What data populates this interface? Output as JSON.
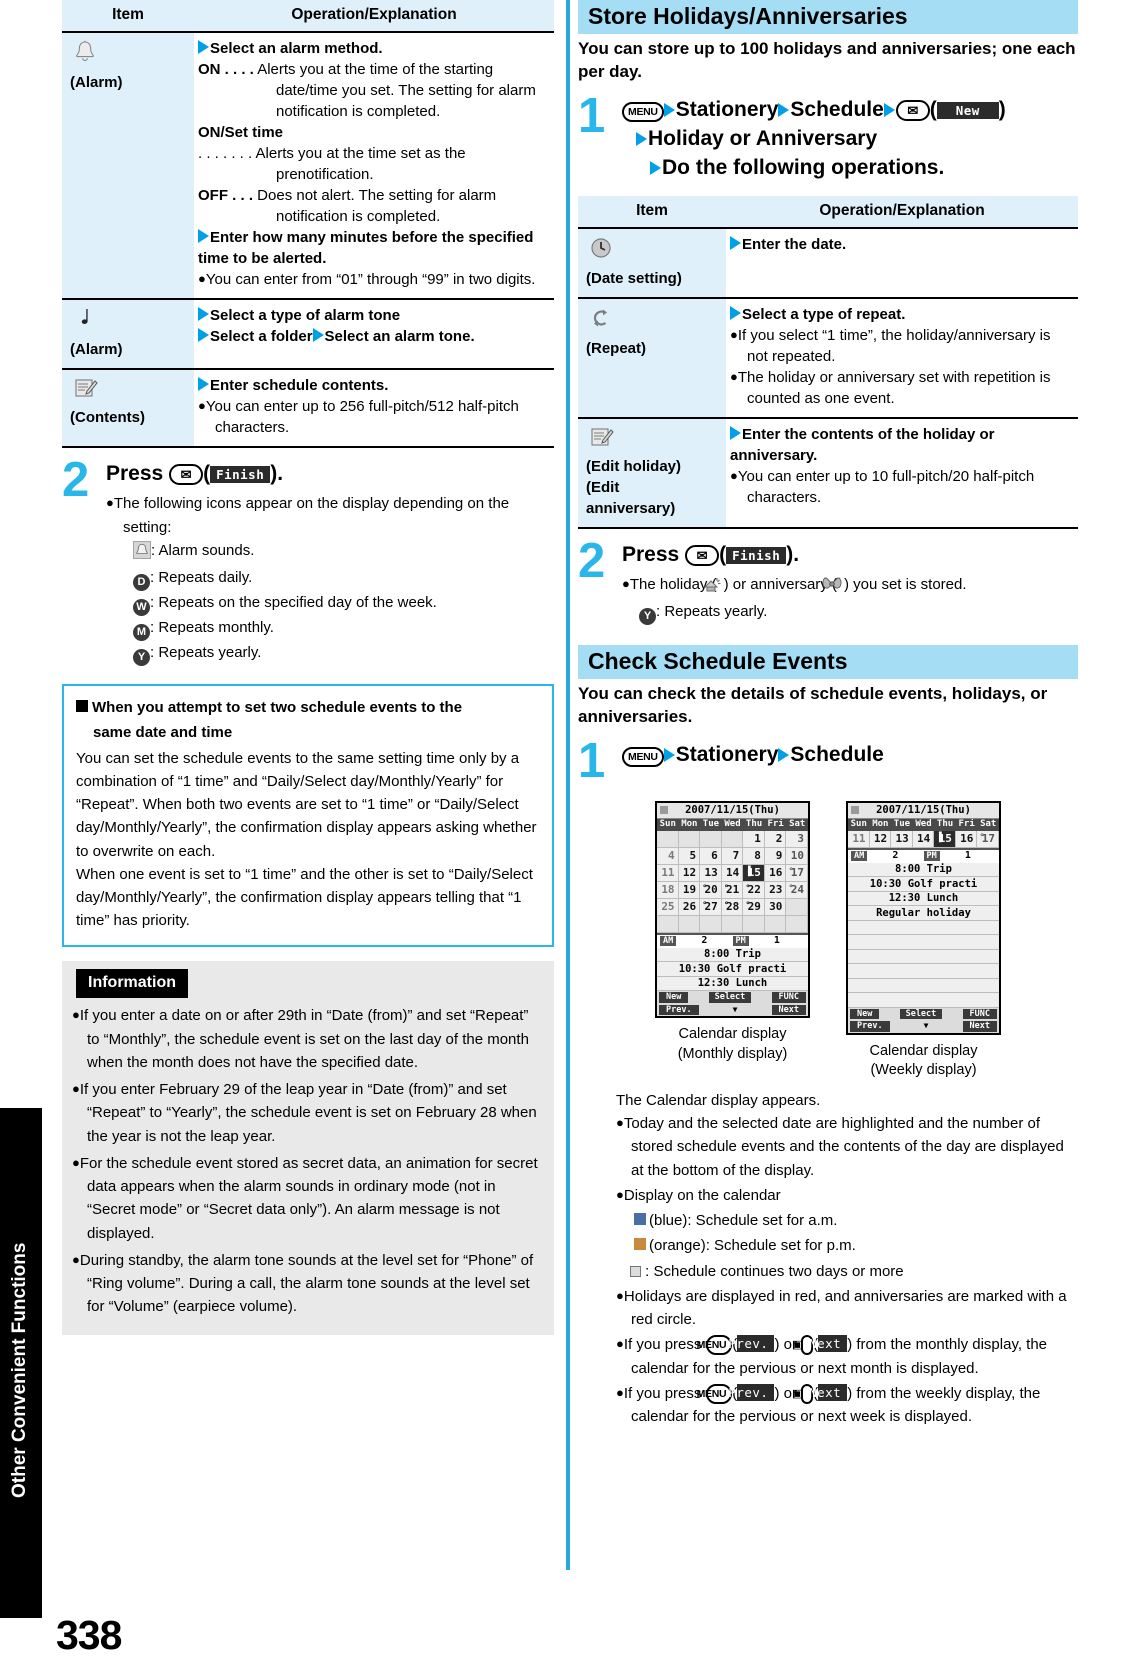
{
  "page": {
    "number": "338",
    "side_tab": "Other Convenient Functions"
  },
  "left": {
    "table": {
      "headers": [
        "Item",
        "Operation/Explanation"
      ],
      "rows": [
        {
          "icon": "bell-icon",
          "item_label": "(Alarm)",
          "lines": [
            {
              "type": "arrow-bold",
              "text": "Select an alarm method."
            },
            {
              "type": "def",
              "term": "ON . . . .",
              "text": "Alerts you at the time of the starting date/time you set. The setting for alarm notification is completed."
            },
            {
              "type": "term-only",
              "text": "ON/Set time"
            },
            {
              "type": "def",
              "term": ". . . . . . .",
              "text": "Alerts you at the time set as the prenotification."
            },
            {
              "type": "def",
              "term": "OFF . . .",
              "text": "Does not alert. The setting for alarm notification is completed."
            },
            {
              "type": "arrow-bold",
              "text": "Enter how many minutes before the specified time to be alerted."
            },
            {
              "type": "bullet",
              "text": "You can enter from “01” through “99” in two digits."
            }
          ]
        },
        {
          "icon": "music-note-icon",
          "item_label": "(Alarm)",
          "lines": [
            {
              "type": "arrow-bold",
              "text": "Select a type of alarm tone"
            },
            {
              "type": "arrow-bold-double",
              "text1": "Select a folder",
              "text2": "Select an alarm tone."
            }
          ]
        },
        {
          "icon": "memo-icon",
          "item_label": "(Contents)",
          "lines": [
            {
              "type": "arrow-bold",
              "text": "Enter schedule contents."
            },
            {
              "type": "bullet",
              "text": "You can enter up to 256 full-pitch/512 half-pitch characters."
            }
          ]
        }
      ]
    },
    "step2": {
      "number": "2",
      "press_label": "Press",
      "key": "envelope-key",
      "softkey": "Finish",
      "period": ").",
      "bullet": "The following icons appear on the display depending on the setting:",
      "icon_list": [
        {
          "icon": "bell-icon",
          "text": ": Alarm sounds."
        },
        {
          "icon": "D",
          "text": ": Repeats daily."
        },
        {
          "icon": "W",
          "text": ": Repeats on the specified day of the week."
        },
        {
          "icon": "M",
          "text": ": Repeats monthly."
        },
        {
          "icon": "Y",
          "text": ": Repeats yearly."
        }
      ]
    },
    "notebox": {
      "title_line1": "When you attempt to set two schedule events to the",
      "title_line2": "same date and time",
      "paragraphs": [
        "You can set the schedule events to the same setting time only by a combination of “1 time” and “Daily/Select day/Monthly/Yearly” for “Repeat”. When both two events are set to “1 time” or “Daily/Select day/Monthly/Yearly”, the confirmation display appears asking whether to overwrite on each.",
        "When one event is set to “1 time” and the other is set to “Daily/Select day/Monthly/Yearly”, the confirmation display appears telling that “1 time” has priority."
      ]
    },
    "infobox": {
      "label": "Information",
      "items": [
        "If you enter a date on or after 29th in “Date (from)” and set “Repeat” to “Monthly”, the schedule event is set on the last day of the month when the month does not have the specified date.",
        "If you enter February 29 of the leap year in “Date (from)” and set “Repeat” to “Yearly”, the schedule event is set on February 28 when the year is not the leap year.",
        "For the schedule event stored as secret data, an animation for secret data appears when the alarm sounds in ordinary mode (not in “Secret mode” or “Secret data only”). An alarm message is not displayed.",
        "During standby, the alarm tone sounds at the level set for “Phone” of “Ring volume”. During a call, the alarm tone sounds at the level set for “Volume” (earpiece volume)."
      ]
    }
  },
  "right": {
    "section1": {
      "heading": "Store Holidays/Anniversaries",
      "lead": "You can store up to 100 holidays and anniversaries; one each per day.",
      "step1": {
        "number": "1",
        "menu_key": "MENU",
        "crumb1": "Stationery",
        "crumb2": "Schedule",
        "env_key": "envelope-key",
        "softkey_new": "New",
        "line2": "Holiday or Anniversary",
        "line3": "Do the following operations."
      },
      "table": {
        "headers": [
          "Item",
          "Operation/Explanation"
        ],
        "rows": [
          {
            "icon": "clock-icon",
            "item_label": "(Date setting)",
            "lines": [
              {
                "type": "arrow-bold",
                "text": "Enter the date."
              }
            ]
          },
          {
            "icon": "repeat-icon",
            "item_label": "(Repeat)",
            "lines": [
              {
                "type": "arrow-bold",
                "text": "Select a type of repeat."
              },
              {
                "type": "bullet",
                "text": "If you select “1 time”, the holiday/anniversary is not repeated."
              },
              {
                "type": "bullet",
                "text": "The holiday or anniversary set with repetition is counted as one event."
              }
            ]
          },
          {
            "icon": "memo-icon",
            "item_label": "(Edit holiday)",
            "item_label2": "(Edit",
            "item_label3": "anniversary)",
            "lines": [
              {
                "type": "arrow-bold",
                "text": "Enter the contents of the holiday or anniversary."
              },
              {
                "type": "bullet",
                "text": "You can enter up to 10 full-pitch/20 half-pitch characters."
              }
            ]
          }
        ]
      },
      "step2": {
        "number": "2",
        "press_label": "Press",
        "key": "envelope-key",
        "softkey": "Finish",
        "bullet_pre": "The holiday (",
        "bullet_mid": ") or anniversary (",
        "bullet_post": ") you set is stored.",
        "yearly": ": Repeats yearly."
      }
    },
    "section2": {
      "heading": "Check Schedule Events",
      "lead": "You can check the details of schedule events, holidays, or anniversaries.",
      "step1": {
        "number": "1",
        "menu_key": "MENU",
        "crumb1": "Stationery",
        "crumb2": "Schedule"
      },
      "shots": [
        {
          "caption_line1": "Calendar display",
          "caption_line2": "(Monthly display)",
          "title": "2007/11/15(Thu)",
          "dow": [
            "Sun",
            "Mon",
            "Tue",
            "Wed",
            "Thu",
            "Fri",
            "Sat"
          ],
          "weeks": [
            [
              "",
              "",
              "",
              "",
              "1",
              "2",
              "3"
            ],
            [
              "4",
              "5",
              "6",
              "7",
              "8",
              "9",
              "10"
            ],
            [
              "11",
              "12",
              "13",
              "14",
              "15",
              "16",
              "17"
            ],
            [
              "18",
              "19",
              "20",
              "21",
              "22",
              "23",
              "24"
            ],
            [
              "25",
              "26",
              "27",
              "28",
              "29",
              "30",
              ""
            ],
            [
              "",
              "",
              "",
              "",
              "",
              "",
              ""
            ]
          ],
          "marks": {
            "17": "°",
            "20": "°",
            "21": "°",
            "22": "°",
            "24": "°",
            "27": "°",
            "28": "°",
            "29": "°"
          },
          "selected": "15",
          "am_label": "AM",
          "am_count": "2",
          "pm_label": "PM",
          "pm_count": "1",
          "events": [
            "8:00 Trip",
            "10:30 Golf practi",
            "12:30 Lunch"
          ],
          "blank_rows": 0,
          "soft": {
            "new": "New",
            "prev": "Prev.",
            "select": "Select",
            "func": "FUNC",
            "next": "Next"
          }
        },
        {
          "caption_line1": "Calendar display",
          "caption_line2": "(Weekly display)",
          "title": "2007/11/15(Thu)",
          "dow": [
            "Sun",
            "Mon",
            "Tue",
            "Wed",
            "Thu",
            "Fri",
            "Sat"
          ],
          "weeks": [
            [
              "11",
              "12",
              "13",
              "14",
              "15",
              "16",
              "17"
            ]
          ],
          "marks": {
            "17": "°"
          },
          "selected": "15",
          "am_label": "AM",
          "am_count": "2",
          "pm_label": "PM",
          "pm_count": "1",
          "events": [
            "8:00 Trip",
            "10:30 Golf practi",
            "12:30 Lunch",
            "Regular holiday"
          ],
          "blank_rows": 6,
          "soft": {
            "new": "New",
            "prev": "Prev.",
            "select": "Select",
            "func": "FUNC",
            "next": "Next"
          }
        }
      ],
      "after": {
        "intro": "The Calendar display appears.",
        "items": [
          "Today and the selected date are highlighted and the number of stored schedule events and the contents of the day are displayed at the bottom of the display.",
          "Display on the calendar"
        ],
        "sub_items": [
          "(blue): Schedule set for a.m.",
          "(orange): Schedule set for p.m."
        ],
        "continues": ": Schedule continues two days or more",
        "items2": [
          "Holidays are displayed in red, and anniversaries are marked with a red circle."
        ],
        "press_line1_a": "If you press",
        "press_line1_softkey1": "Prev.",
        "press_line1_or": ") or",
        "press_line1_softkey2": "Next",
        "press_line1_b": ") from the monthly display, the calendar for the pervious or next month is displayed.",
        "press_line2_a": "If you press",
        "press_line2_b": ") from the weekly display, the calendar for the pervious or next week is displayed.",
        "menu_key": "MENU",
        "cam_key": "camera-key"
      }
    }
  }
}
